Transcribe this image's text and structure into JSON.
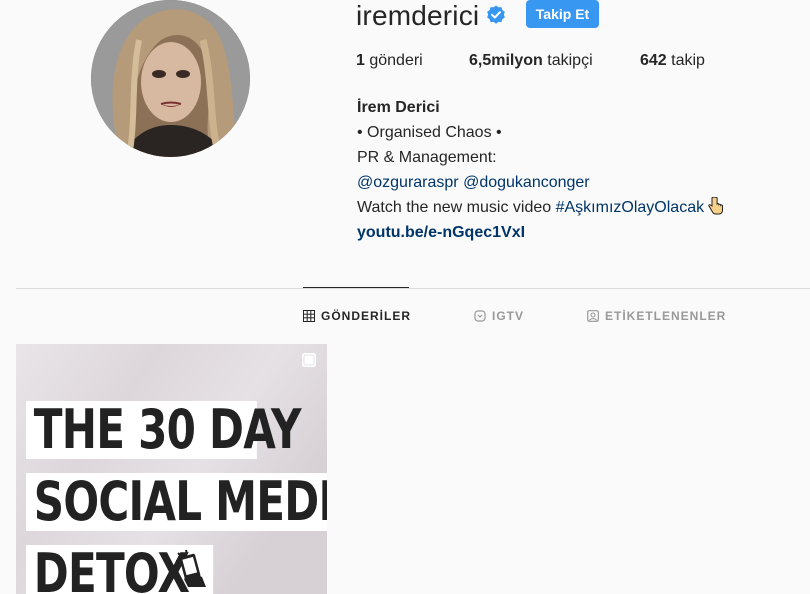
{
  "profile": {
    "username": "iremderici",
    "follow_label": "Takip Et",
    "stats": {
      "posts_count": "1",
      "posts_label": "gönderi",
      "followers_count": "6,5milyon",
      "followers_label": "takipçi",
      "following_count": "642",
      "following_label": "takip"
    },
    "bio": {
      "name": "İrem Derici",
      "line1": "• Organised Chaos •",
      "line2": "PR & Management:",
      "mention1": "@ozguraraspr",
      "mention2": "@dogukanconger",
      "line4_text": "Watch the new music video",
      "hashtag": "#AşkımızOlayOlacak",
      "url": "youtu.be/e-nGqec1VxI"
    }
  },
  "tabs": [
    {
      "label": "GÖNDERİLER",
      "icon": "grid-icon",
      "active": true
    },
    {
      "label": "IGTV",
      "icon": "igtv-icon",
      "active": false
    },
    {
      "label": "ETİKETLENENLER",
      "icon": "tagged-icon",
      "active": false
    }
  ],
  "post": {
    "line1": "THE 30 DAY",
    "line2": "SOCIAL MEDIA",
    "line3": "DETOX",
    "icon": "multiple-posts-icon"
  },
  "colors": {
    "accent": "#3897f0",
    "link": "#003569",
    "background": "#fafafa",
    "divider": "#dbdbdb"
  }
}
